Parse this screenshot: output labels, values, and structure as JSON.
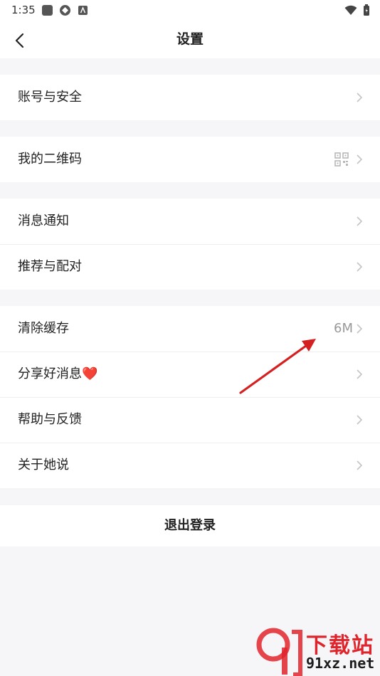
{
  "status_bar": {
    "time": "1:35"
  },
  "header": {
    "title": "设置"
  },
  "groups": [
    {
      "items": [
        {
          "label": "账号与安全"
        }
      ]
    },
    {
      "items": [
        {
          "label": "我的二维码",
          "icon": "qr-code-icon"
        }
      ]
    },
    {
      "items": [
        {
          "label": "消息通知"
        },
        {
          "label": "推荐与配对"
        }
      ]
    },
    {
      "items": [
        {
          "label": "清除缓存",
          "value": "6M"
        },
        {
          "label": "分享好消息",
          "emoji": "❤️"
        },
        {
          "label": "帮助与反馈"
        },
        {
          "label": "关于她说"
        }
      ]
    }
  ],
  "logout": {
    "label": "退出登录"
  },
  "watermark": {
    "title": "下载站",
    "url": "91xz.net"
  },
  "colors": {
    "background": "#f6f6f8",
    "arrow": "#d42020",
    "watermark_red": "#e0242c"
  }
}
